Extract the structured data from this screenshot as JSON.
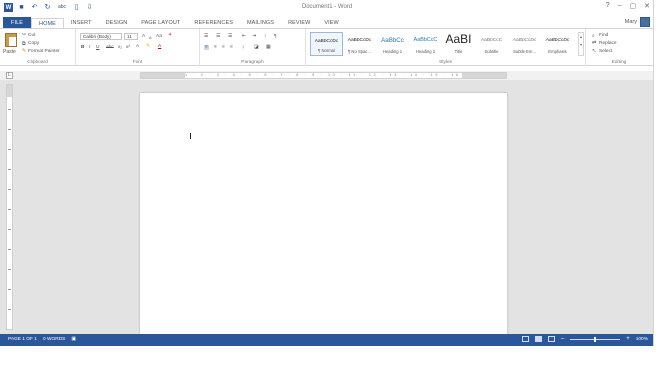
{
  "window": {
    "title": "Document1 - Word",
    "app_icon": "W",
    "controls": [
      "?",
      "–",
      "▢",
      "✕"
    ]
  },
  "quick_access": {
    "save_icon": "💾",
    "undo_icon": "↶",
    "redo_icon": "↻",
    "spelling_icon": "abc",
    "new_icon": "▯",
    "customize_icon": "⇩"
  },
  "tabs": [
    {
      "label": "FILE"
    },
    {
      "label": "HOME"
    },
    {
      "label": "INSERT"
    },
    {
      "label": "DESIGN"
    },
    {
      "label": "PAGE LAYOUT"
    },
    {
      "label": "REFERENCES"
    },
    {
      "label": "MAILINGS"
    },
    {
      "label": "REVIEW"
    },
    {
      "label": "VIEW"
    }
  ],
  "account": {
    "name": "Mary"
  },
  "clipboard": {
    "group_label": "Clipboard",
    "paste": "Paste",
    "cut": "Cut",
    "copy": "Copy",
    "format_painter": "Format Painter"
  },
  "font": {
    "group_label": "Font",
    "font_name": "Calibri (Body)",
    "font_size": "11",
    "grow": "A",
    "shrink": "A",
    "change_case": "Aa",
    "bold": "B",
    "italic": "I",
    "underline": "U",
    "strikethrough": "abc",
    "subscript": "x₂",
    "superscript": "x²"
  },
  "paragraph": {
    "group_label": "Paragraph"
  },
  "styles": {
    "group_label": "Styles",
    "items": [
      {
        "sample": "AaBbCcDc",
        "name": "¶ Normal",
        "kind": "normal"
      },
      {
        "sample": "AaBbCcDc",
        "name": "¶ No Spac...",
        "kind": "normal"
      },
      {
        "sample": "AaBbCc",
        "name": "Heading 1",
        "kind": "heading"
      },
      {
        "sample": "AaBbCcC",
        "name": "Heading 2",
        "kind": "heading"
      },
      {
        "sample": "AaBI",
        "name": "Title",
        "kind": "title"
      },
      {
        "sample": "AaBbCcC",
        "name": "Subtitle",
        "kind": "subtle"
      },
      {
        "sample": "AaBbCcDc",
        "name": "Subtle Em...",
        "kind": "subtle"
      },
      {
        "sample": "AaBbCcDc",
        "name": "Emphasis",
        "kind": "normal"
      }
    ]
  },
  "editing": {
    "group_label": "Editing",
    "find": "Find",
    "replace": "Replace",
    "select": "Select"
  },
  "ruler": {
    "corner": "L",
    "numbers": "1 · 2 · 3 · 4 · 5 · 6 · 7 · 8 · 9 · 10 · 11 · 12 · 13 · 14 · 15 · 16"
  },
  "status": {
    "page": "PAGE 1 OF 1",
    "words": "0 WORDS",
    "proofing_icon": "📖",
    "zoom_minus": "–",
    "zoom_plus": "+",
    "zoom": "100%"
  },
  "colors": {
    "accent": "#2b579a",
    "heading": "#2e74b5"
  }
}
